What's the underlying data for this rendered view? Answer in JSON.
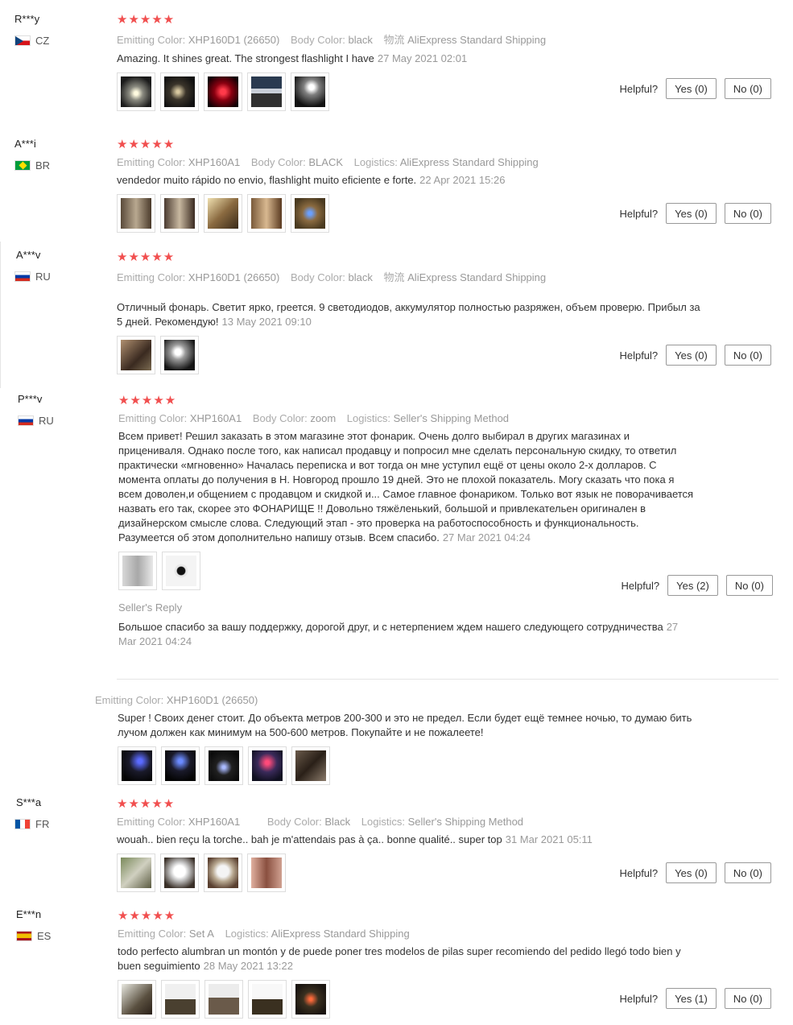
{
  "helpful_label": "Helpful?",
  "seller_reply_label": "Seller's Reply",
  "reviews": [
    {
      "user": "R***y",
      "country": "CZ",
      "stars": "★★★★★",
      "attr1_k": "Emitting Color:",
      "attr1_v": "XHP160D1 (26650)",
      "attr2_k": "Body Color:",
      "attr2_v": "black",
      "attr3_k": "物流",
      "attr3_v": "AliExpress Standard Shipping",
      "text": "Amazing. It shines great. The strongest flashlight I have",
      "date": "27 May 2021 02:01",
      "yes": "Yes (0)",
      "no": "No (0)"
    },
    {
      "user": "A***i",
      "country": "BR",
      "stars": "★★★★★",
      "attr1_k": "Emitting Color:",
      "attr1_v": "XHP160A1",
      "attr2_k": "Body Color:",
      "attr2_v": "BLACK",
      "attr3_k": "Logistics:",
      "attr3_v": "AliExpress Standard Shipping",
      "text": "vendedor muito rápido no envio, flashlight muito eficiente e forte.",
      "date": "22 Apr 2021 15:26",
      "yes": "Yes (0)",
      "no": "No (0)"
    },
    {
      "user": "A***v",
      "country": "RU",
      "stars": "★★★★★",
      "attr1_k": "Emitting Color:",
      "attr1_v": "XHP160D1 (26650)",
      "attr2_k": "Body Color:",
      "attr2_v": "black",
      "attr3_k": "物流",
      "attr3_v": "AliExpress Standard Shipping",
      "text": "Отличный фонарь. Светит ярко, греется. 9 светодиодов, аккумулятор полностью разряжен, объем проверю. Прибыл за 5 дней. Рекомендую!",
      "date": "13 May 2021 09:10",
      "yes": "Yes (0)",
      "no": "No (0)"
    },
    {
      "user": "P***v",
      "country": "RU",
      "stars": "★★★★★",
      "attr1_k": "Emitting Color:",
      "attr1_v": "XHP160A1",
      "attr2_k": "Body Color:",
      "attr2_v": "zoom",
      "attr3_k": "Logistics:",
      "attr3_v": "Seller's Shipping Method",
      "text": "Всем привет! Решил заказать в этом магазине этот фонарик. Очень долго выбирал в других магазинах и прицениваля. Однако после того, как написал продавцу и попросил мне сделать персональную скидку, то ответил практически «мгновенно» Началась переписка и вот тогда он мне уступил ещё от цены около 2-х долларов. С момента оплаты до получения в Н. Новгород прошло 19 дней. Это не плохой показатель. Могу сказать что пока я всем доволен,и общением с продавцом и скидкой и... Самое главное фонариком. Только вот язык не поворачивается назвать его так, скорее это ФОНАРИЩЕ !! Довольно тяжёленький, большой и привлекательен оригинален в дизайнерском смысле слова. Следующий этап - это проверка на работоспособность и функциональность. Разумеется об этом дополнительно напишу отзыв. Всем спасибо.",
      "date": "27 Mar 2021 04:24",
      "yes": "Yes (2)",
      "no": "No (0)",
      "reply_text": "Большое спасибо за вашу поддержку, дорогой друг, и с нетерпением ждем нашего следующего сотрудничества",
      "reply_date": "27 Mar 2021 04:24"
    },
    {
      "attr1_k": "Emitting Color:",
      "attr1_v": "XHP160D1 (26650)",
      "text": "Super ! Своих денег стоит. До объекта метров 200-300 и это не предел. Если будет ещё темнее ночью, то думаю бить лучом должен как минимум на 500-600 метров. Покупайте и не пожалеете!"
    },
    {
      "user": "S***a",
      "country": "FR",
      "stars": "★★★★★",
      "attr1_k": "Emitting Color:",
      "attr1_v": "XHP160A1",
      "attr2_k": "Body Color:",
      "attr2_v": "Black",
      "attr3_k": "Logistics:",
      "attr3_v": "Seller's Shipping Method",
      "text": "wouah.. bien reçu la torche.. bah je m'attendais pas à ça.. bonne qualité.. super top",
      "date": "31 Mar 2021 05:11",
      "yes": "Yes (0)",
      "no": "No (0)"
    },
    {
      "user": "E***n",
      "country": "ES",
      "stars": "★★★★★",
      "attr1_k": "Emitting Color:",
      "attr1_v": "Set A",
      "attr2_k": "Logistics:",
      "attr2_v": "AliExpress Standard Shipping",
      "text": "todo perfecto alumbran un montón y de puede poner tres modelos de pilas super recomiendo del pedido llegó todo bien y buen seguimiento",
      "date": "28 May 2021 13:22",
      "yes": "Yes (1)",
      "no": "No (0)"
    }
  ],
  "colors": {
    "star": "#f14f4f",
    "muted": "#999999"
  }
}
